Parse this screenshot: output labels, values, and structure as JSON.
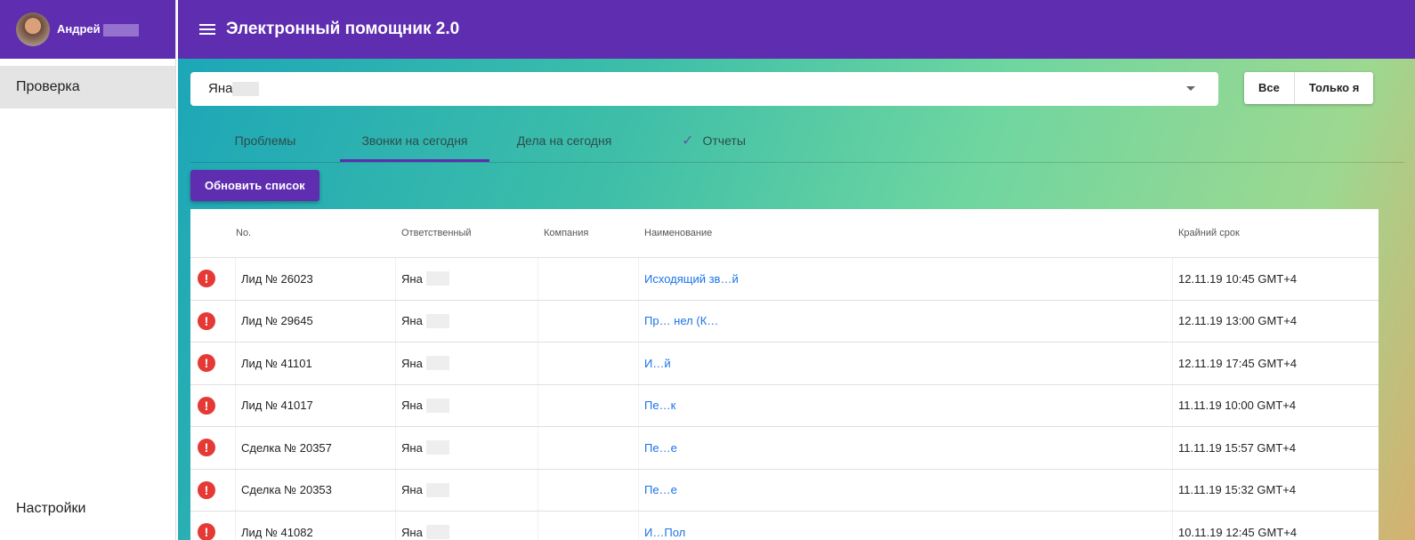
{
  "sidebar": {
    "user_name": "Андрей",
    "items": [
      {
        "label": "Проверка"
      }
    ],
    "bottom_item": "Настройки"
  },
  "appbar": {
    "title": "Электронный помощник 2.0"
  },
  "filter": {
    "selected": "Яна",
    "toggle": [
      "Все",
      "Только я"
    ]
  },
  "tabs": [
    {
      "label": "Проблемы"
    },
    {
      "label": "Звонки на сегодня",
      "active": true
    },
    {
      "label": "Дела на сегодня"
    },
    {
      "label": "Отчеты",
      "icon": "check-icon"
    }
  ],
  "refresh_label": "Обновить список",
  "table": {
    "headers": [
      "No.",
      "Ответственный",
      "Компания",
      "Наименование",
      "Крайний срок"
    ],
    "rows": [
      {
        "no": "Лид № 26023",
        "owner": "Яна",
        "company": "",
        "name": "Исходящий зв…й",
        "deadline": "12.11.19 10:45 GMT+4"
      },
      {
        "no": "Лид № 29645",
        "owner": "Яна",
        "company": "",
        "name": "Пр… нел (К…",
        "deadline": "12.11.19 13:00 GMT+4"
      },
      {
        "no": "Лид № 41101",
        "owner": "Яна",
        "company": "",
        "name": "И…й",
        "deadline": "12.11.19 17:45 GMT+4"
      },
      {
        "no": "Лид № 41017",
        "owner": "Яна",
        "company": "",
        "name": "Пе…к",
        "deadline": "11.11.19 10:00 GMT+4"
      },
      {
        "no": "Сделка № 20357",
        "owner": "Яна",
        "company": "",
        "name": "Пе…е",
        "deadline": "11.11.19 15:57 GMT+4"
      },
      {
        "no": "Сделка № 20353",
        "owner": "Яна",
        "company": "",
        "name": "Пе…е",
        "deadline": "11.11.19 15:32 GMT+4"
      },
      {
        "no": "Лид № 41082",
        "owner": "Яна",
        "company": "",
        "name": "И…Пол",
        "deadline": "10.11.19 12:45 GMT+4"
      }
    ]
  },
  "colors": {
    "primary": "#5e2db0",
    "error": "#e53935",
    "link": "#1a73e8"
  }
}
